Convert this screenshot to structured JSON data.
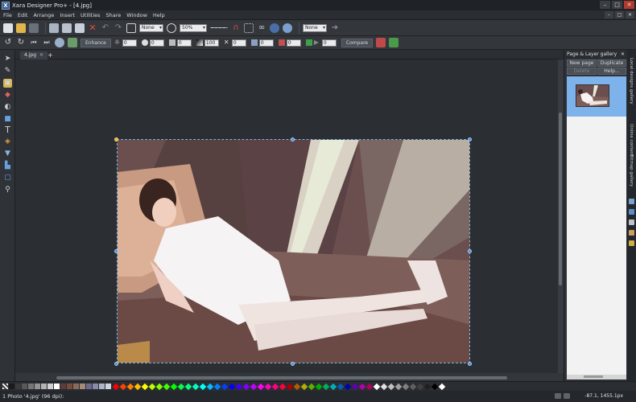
{
  "window": {
    "title": "Xara Designer Pro+ - [4.jpg]",
    "app_icon": "X",
    "controls": [
      "–",
      "□",
      "✕"
    ]
  },
  "menu": {
    "items": [
      "File",
      "Edit",
      "Arrange",
      "Insert",
      "Utilities",
      "Share",
      "Window",
      "Help"
    ],
    "doc_controls": [
      "–",
      "□",
      "✕"
    ]
  },
  "toolbar1": {
    "fill_select": "None",
    "zoom_select": "50%",
    "line_select": "None"
  },
  "toolbar2": {
    "enhance_label": "Enhance",
    "values": [
      "0",
      "0",
      "0",
      "100",
      "0",
      "0",
      "0",
      "0"
    ],
    "compare_label": "Compare"
  },
  "tabs": {
    "doc_tab": "4.jpg",
    "close": "✕",
    "add": "+"
  },
  "gallery": {
    "title": "Page & Layer gallery",
    "new_page": "New page",
    "duplicate": "Duplicate",
    "delete": "Delete",
    "help": "Help..."
  },
  "vtabs": [
    "Local designs gallery",
    "Online content",
    "Bitmap gallery"
  ],
  "status": {
    "text": "1 Photo '4.jpg' (96 dpi):",
    "coords": "-87.1, 1455.1px"
  },
  "colors": {
    "selection_handle": "#4a8fd6",
    "accent_tool": "#d8b24a",
    "gallery_selection": "#7db3ea"
  },
  "palette": {
    "swatches": [
      "#1b1b1b",
      "#3a3a3a",
      "#585858",
      "#767676",
      "#949494",
      "#b2b2b2",
      "#d0d0d0",
      "#ffffff",
      "#5c3b3b",
      "#7a4b3b",
      "#8a6b5b",
      "#a58a7a",
      "#6b6b8a",
      "#8a8aa8",
      "#aeb6c6",
      "#cdd5e0"
    ],
    "diamonds": [
      "#ff0000",
      "#ff4000",
      "#ff8000",
      "#ffbf00",
      "#ffff00",
      "#bfff00",
      "#80ff00",
      "#40ff00",
      "#00ff00",
      "#00ff40",
      "#00ff80",
      "#00ffbf",
      "#00ffff",
      "#00bfff",
      "#0080ff",
      "#0040ff",
      "#0000ff",
      "#4000ff",
      "#8000ff",
      "#bf00ff",
      "#ff00ff",
      "#ff00bf",
      "#ff0080",
      "#ff0040",
      "#b00000",
      "#b06000",
      "#b0b000",
      "#60b000",
      "#00b000",
      "#00b060",
      "#00b0b0",
      "#0060b0",
      "#0000b0",
      "#6000b0",
      "#b000b0",
      "#b00060",
      "#ffffff",
      "#e0e0e0",
      "#c0c0c0",
      "#a0a0a0",
      "#808080",
      "#606060",
      "#404040",
      "#202020",
      "#000000",
      "#ffffff"
    ]
  }
}
